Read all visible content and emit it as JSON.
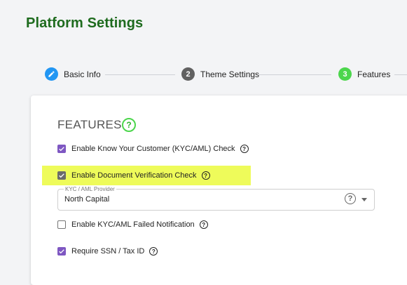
{
  "page": {
    "title": "Platform Settings"
  },
  "stepper": {
    "steps": [
      {
        "number": "",
        "label": "Basic Info",
        "state": "done",
        "icon": "pencil-icon",
        "color": "#2196f3"
      },
      {
        "number": "2",
        "label": "Theme Settings",
        "state": "upcoming",
        "color": "#616161"
      },
      {
        "number": "3",
        "label": "Features",
        "state": "active",
        "color": "#4cd64c"
      }
    ]
  },
  "features": {
    "title": "FEATURES",
    "help_icon": "help-circle-icon",
    "options": [
      {
        "label": "Enable Know Your Customer (KYC/AML) Check",
        "checked": true
      },
      {
        "label": "Enable Document Verification Check",
        "checked": true,
        "highlighted": true
      },
      {
        "label": "Enable KYC/AML Failed Notification",
        "checked": false
      },
      {
        "label": "Require SSN / Tax ID",
        "checked": true
      }
    ],
    "provider": {
      "label": "KYC / AML Provider",
      "value": "North Capital"
    }
  },
  "colors": {
    "title": "#1e6b1e",
    "checkbox": "#7e57c2",
    "highlight": "#eefb5a"
  }
}
